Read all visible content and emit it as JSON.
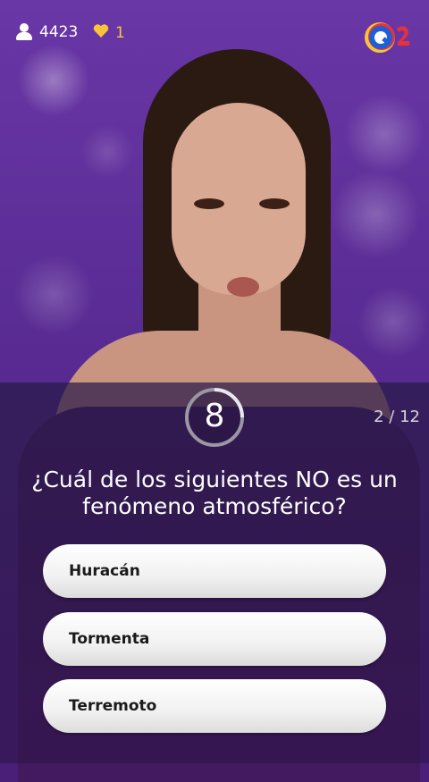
{
  "header": {
    "user_count": "4423",
    "lives_count": "1",
    "logo_letter": "Q"
  },
  "question": {
    "timer_seconds": "8",
    "progress": "2 / 12",
    "text": "¿Cuál de los siguientes NO es un fenómeno atmosférico?",
    "answers": [
      {
        "label": "Huracán"
      },
      {
        "label": "Tormenta"
      },
      {
        "label": "Terremoto"
      }
    ]
  },
  "colors": {
    "background_purple": "#5a2c95",
    "lives_yellow": "#f7c43a",
    "logo_blue": "#1f5fd6",
    "logo_red": "#e8323a",
    "logo_yellow": "#f7c43a",
    "answer_bg": "#f1f1f1"
  },
  "icons": [
    "user-icon",
    "heart-icon",
    "q-logo-icon",
    "timer-ring-icon"
  ]
}
